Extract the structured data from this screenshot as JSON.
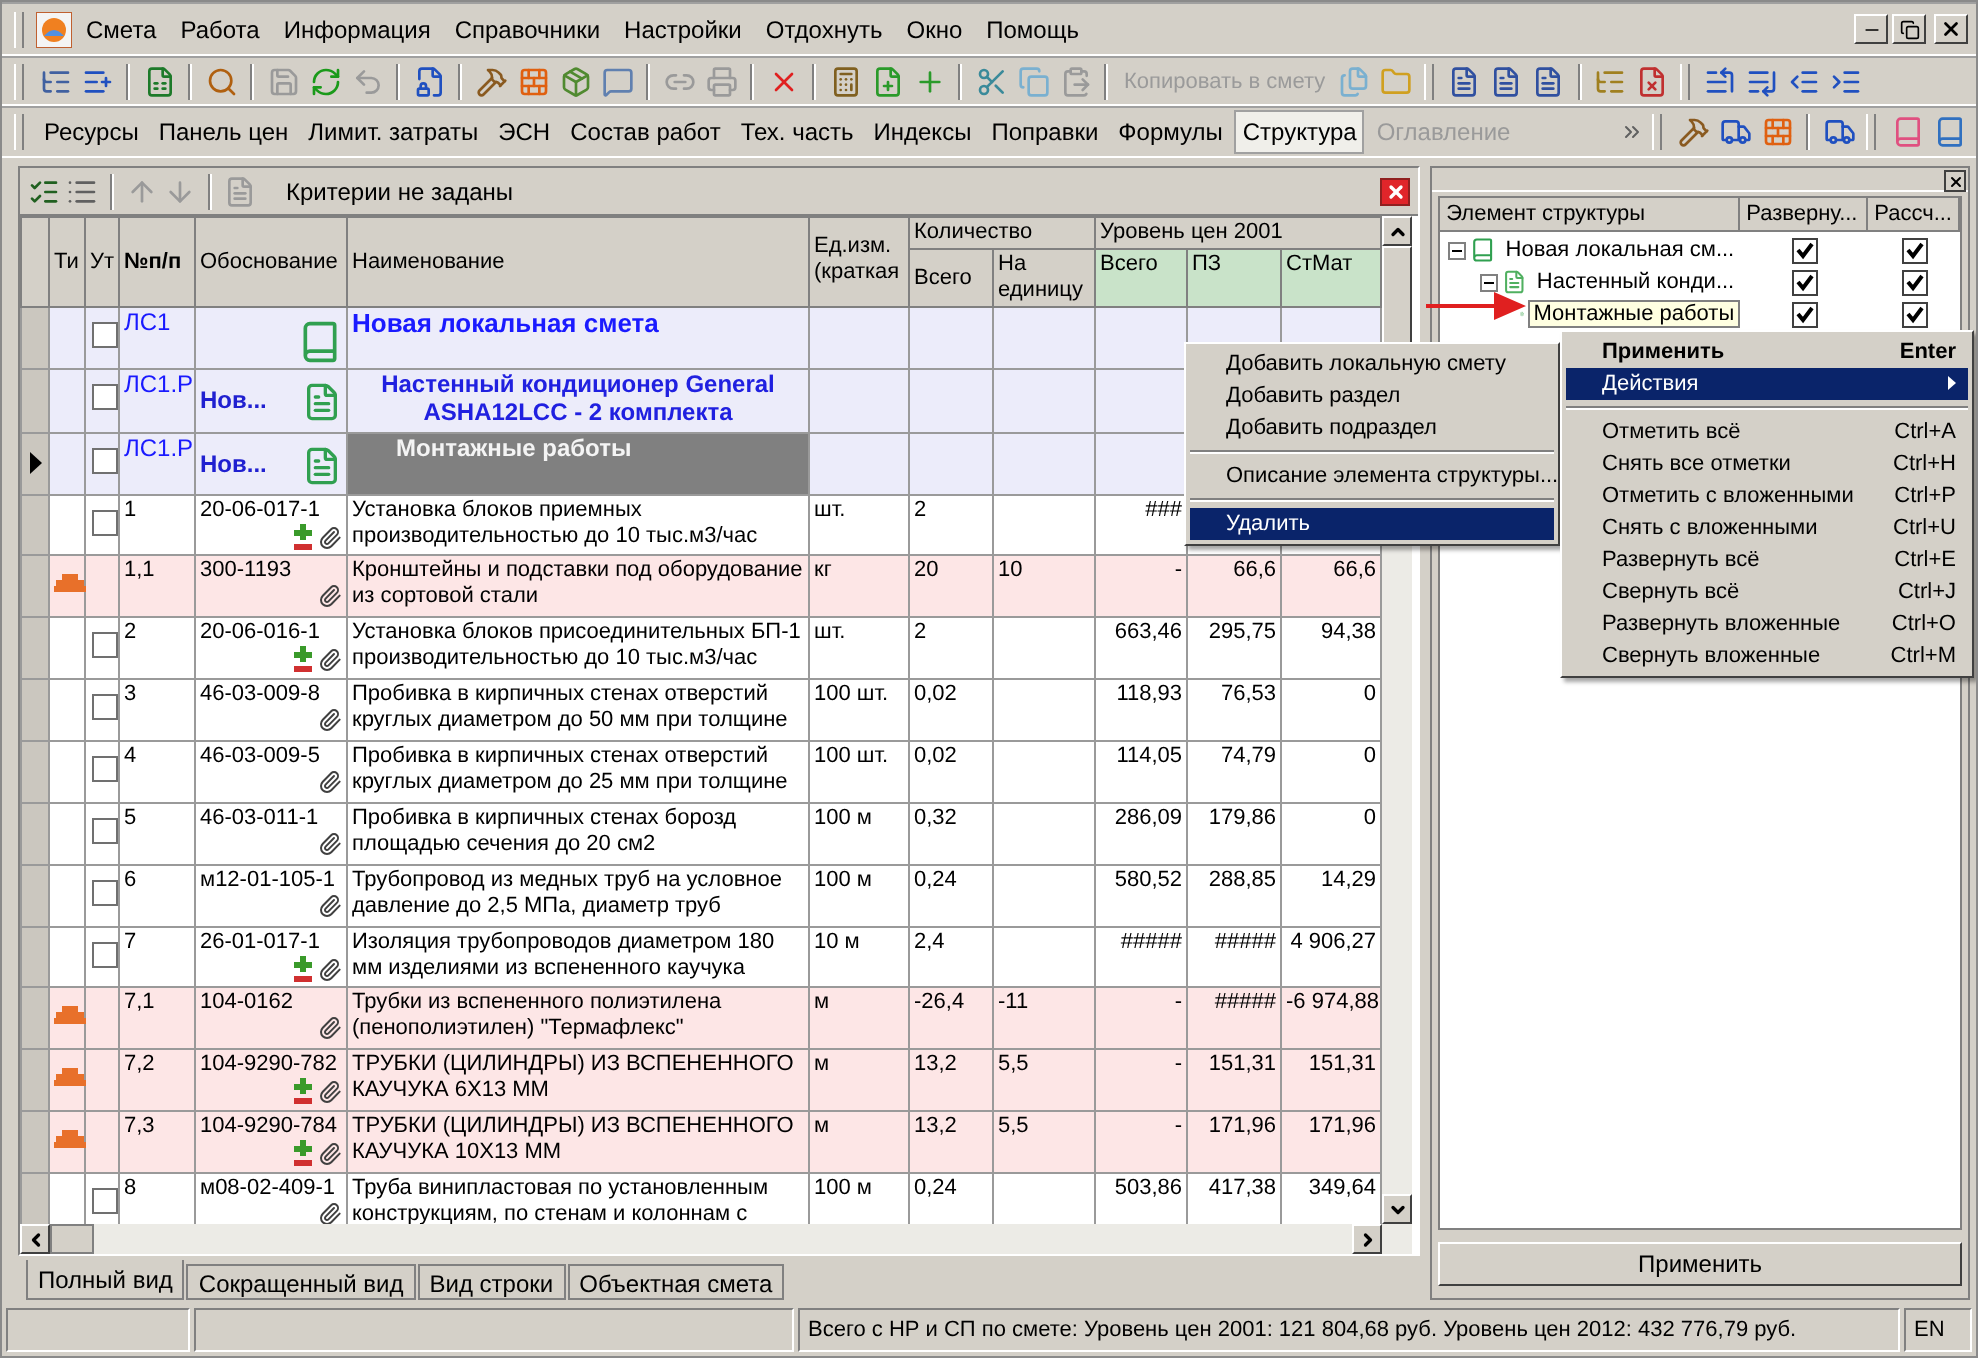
{
  "menu": [
    "Смета",
    "Работа",
    "Информация",
    "Справочники",
    "Настройки",
    "Отдохнуть",
    "Окно",
    "Помощь"
  ],
  "toolbar": {
    "copy_button": {
      "label": "Копировать в смету",
      "disabled": true
    }
  },
  "view_tabs": [
    {
      "label": "Ресурсы",
      "selected": false,
      "disabled": false
    },
    {
      "label": "Панель цен",
      "selected": false,
      "disabled": false
    },
    {
      "label": "Лимит. затраты",
      "selected": false,
      "disabled": false
    },
    {
      "label": "ЭСН",
      "selected": false,
      "disabled": false
    },
    {
      "label": "Состав работ",
      "selected": false,
      "disabled": false
    },
    {
      "label": "Тех. часть",
      "selected": false,
      "disabled": false
    },
    {
      "label": "Индексы",
      "selected": false,
      "disabled": false
    },
    {
      "label": "Поправки",
      "selected": false,
      "disabled": false
    },
    {
      "label": "Формулы",
      "selected": false,
      "disabled": false
    },
    {
      "label": "Структура",
      "selected": true,
      "disabled": false
    },
    {
      "label": "Оглавление",
      "selected": false,
      "disabled": true
    }
  ],
  "filter": {
    "text": "Критерии не заданы"
  },
  "table": {
    "columns": [
      "Ти",
      "Ут",
      "№п/п",
      "Обоснование",
      "Наименование",
      "Ед.изм. (краткая"
    ],
    "quantity_group": {
      "title": "Количество",
      "columns": [
        "Всего",
        "На единицу"
      ]
    },
    "price_group": {
      "title": "Уровень цен 2001",
      "columns": [
        "Всего",
        "ПЗ",
        "СтМат"
      ]
    },
    "rows": [
      {
        "kind": "estimate",
        "current": false,
        "checked": false,
        "number": "ЛС1",
        "name": "Новая локальная смета"
      },
      {
        "kind": "section",
        "current": false,
        "checked": false,
        "number": "ЛС1.Р",
        "basis": "Нов...",
        "name": "Настенный кондиционер General ASHA12LCC - 2 комплекта"
      },
      {
        "kind": "subsection",
        "current": true,
        "checked": false,
        "number": "ЛС1.Р",
        "basis": "Нов...",
        "name": "Монтажные работы"
      },
      {
        "kind": "work",
        "current": false,
        "checked": false,
        "number": "1",
        "basis": "20-06-017-1",
        "resources": true,
        "name": "Установка блоков приемных производительностью до 10 тыс.м3/час",
        "unit": "шт.",
        "qty_total": "2",
        "price_total": "###"
      },
      {
        "kind": "material",
        "current": false,
        "number": "1,1",
        "basis": "300-1193",
        "resources": false,
        "name": "Кронштейны и подставки под оборудование из сортовой стали",
        "unit": "кг",
        "qty_total": "20",
        "qty_per_unit": "10",
        "price_total": "-",
        "price_pz": "66,6",
        "price_mat": "66,6"
      },
      {
        "kind": "work",
        "current": false,
        "checked": false,
        "number": "2",
        "basis": "20-06-016-1",
        "resources": true,
        "name": "Установка блоков присоединительных БП-1 производительностью до 10 тыс.м3/час",
        "unit": "шт.",
        "qty_total": "2",
        "price_total": "663,46",
        "price_pz": "295,75",
        "price_mat": "94,38"
      },
      {
        "kind": "work",
        "current": false,
        "checked": false,
        "number": "3",
        "basis": "46-03-009-8",
        "resources": false,
        "name": "Пробивка в кирпичных стенах отверстий круглых диаметром до 50 мм при толщине",
        "unit": "100 шт.",
        "qty_total": "0,02",
        "price_total": "118,93",
        "price_pz": "76,53",
        "price_mat": "0"
      },
      {
        "kind": "work",
        "current": false,
        "checked": false,
        "number": "4",
        "basis": "46-03-009-5",
        "resources": false,
        "name": "Пробивка в кирпичных стенах отверстий круглых диаметром до 25 мм при толщине",
        "unit": "100 шт.",
        "qty_total": "0,02",
        "price_total": "114,05",
        "price_pz": "74,79",
        "price_mat": "0"
      },
      {
        "kind": "work",
        "current": false,
        "checked": false,
        "number": "5",
        "basis": "46-03-011-1",
        "resources": false,
        "name": "Пробивка в кирпичных стенах борозд площадью сечения до 20 см2",
        "unit": "100 м",
        "qty_total": "0,32",
        "price_total": "286,09",
        "price_pz": "179,86",
        "price_mat": "0"
      },
      {
        "kind": "work",
        "current": false,
        "checked": false,
        "number": "6",
        "basis": "м12-01-105-1",
        "resources": false,
        "name": "Трубопровод из медных труб на условное давление до 2,5 МПа, диаметр труб",
        "unit": "100 м",
        "qty_total": "0,24",
        "price_total": "580,52",
        "price_pz": "288,85",
        "price_mat": "14,29"
      },
      {
        "kind": "work",
        "current": false,
        "checked": false,
        "number": "7",
        "basis": "26-01-017-1",
        "resources": true,
        "name": "Изоляция трубопроводов диаметром 180 мм изделиями из вспененного каучука",
        "unit": "10 м",
        "qty_total": "2,4",
        "price_total": "#####",
        "price_pz": "#####",
        "price_mat": "4 906,27"
      },
      {
        "kind": "material",
        "current": false,
        "number": "7,1",
        "basis": "104-0162",
        "resources": false,
        "name": "Трубки из вспененного полиэтилена (пенополиэтилен) \"Термафлекс\"",
        "unit": "м",
        "qty_total": "-26,4",
        "qty_per_unit": "-11",
        "price_total": "-",
        "price_pz": "#####",
        "price_mat": "-6 974,88"
      },
      {
        "kind": "material",
        "current": false,
        "number": "7,2",
        "basis": "104-9290-782",
        "resources": true,
        "name": "ТРУБКИ (ЦИЛИНДРЫ) ИЗ ВСПЕНЕННОГО КАУЧУКА 6Х13 ММ",
        "unit": "м",
        "qty_total": "13,2",
        "qty_per_unit": "5,5",
        "price_total": "-",
        "price_pz": "151,31",
        "price_mat": "151,31"
      },
      {
        "kind": "material",
        "current": false,
        "number": "7,3",
        "basis": "104-9290-784",
        "resources": true,
        "name": "ТРУБКИ (ЦИЛИНДРЫ) ИЗ ВСПЕНЕННОГО КАУЧУКА 10Х13 ММ",
        "unit": "м",
        "qty_total": "13,2",
        "qty_per_unit": "5,5",
        "price_total": "-",
        "price_pz": "171,96",
        "price_mat": "171,96"
      },
      {
        "kind": "work",
        "current": false,
        "checked": false,
        "number": "8",
        "basis": "м08-02-409-1",
        "resources": false,
        "name": "Труба винипластовая по установленным конструкциям, по стенам и колоннам с",
        "unit": "100 м",
        "qty_total": "0,24",
        "price_total": "503,86",
        "price_pz": "417,38",
        "price_mat": "349,64"
      }
    ]
  },
  "bottom_tabs": [
    {
      "label": "Полный вид",
      "selected": true
    },
    {
      "label": "Сокращенный вид",
      "selected": false
    },
    {
      "label": "Вид строки",
      "selected": false
    },
    {
      "label": "Объектная смета",
      "selected": false
    }
  ],
  "structure": {
    "columns": [
      "Элемент структуры",
      "Разверну...",
      "Рассч..."
    ],
    "items": [
      {
        "label": "Новая локальная см...",
        "expanded": true,
        "unfold": true,
        "calculate": true,
        "selected": false,
        "children": [
          {
            "label": "Настенный конди...",
            "expanded": true,
            "unfold": true,
            "calculate": true,
            "selected": false,
            "children": [
              {
                "label": "Монтажные работы",
                "unfold": true,
                "calculate": true,
                "selected": true
              }
            ]
          }
        ]
      }
    ],
    "button": "Применить"
  },
  "context_menu": {
    "items": [
      {
        "kind": "item",
        "label": "Добавить локальную смету",
        "selected": false
      },
      {
        "kind": "item",
        "label": "Добавить раздел",
        "selected": false
      },
      {
        "kind": "item",
        "label": "Добавить подраздел",
        "selected": false
      },
      {
        "kind": "separator"
      },
      {
        "kind": "item",
        "label": "Описание элемента структуры...",
        "selected": false
      },
      {
        "kind": "separator"
      },
      {
        "kind": "item",
        "label": "Удалить",
        "selected": true
      }
    ]
  },
  "actions_menu": {
    "items": [
      {
        "kind": "item",
        "label": "Применить",
        "shortcut": "Enter",
        "default": true,
        "selected": false
      },
      {
        "kind": "submenu",
        "label": "Действия",
        "selected": true
      },
      {
        "kind": "separator"
      },
      {
        "kind": "item",
        "label": "Отметить всё",
        "shortcut": "Ctrl+A",
        "selected": false
      },
      {
        "kind": "item",
        "label": "Снять все отметки",
        "shortcut": "Ctrl+H",
        "selected": false
      },
      {
        "kind": "item",
        "label": "Отметить с вложенными",
        "shortcut": "Ctrl+P",
        "selected": false
      },
      {
        "kind": "item",
        "label": "Снять с вложенными",
        "shortcut": "Ctrl+U",
        "selected": false
      },
      {
        "kind": "item",
        "label": "Развернуть всё",
        "shortcut": "Ctrl+E",
        "selected": false
      },
      {
        "kind": "item",
        "label": "Свернуть всё",
        "shortcut": "Ctrl+J",
        "selected": false
      },
      {
        "kind": "item",
        "label": "Развернуть вложенные",
        "shortcut": "Ctrl+O",
        "selected": false
      },
      {
        "kind": "item",
        "label": "Свернуть вложенные",
        "shortcut": "Ctrl+M",
        "selected": false
      }
    ]
  },
  "status_bar": {
    "summary": "Всего с НР и СП по смете: Уровень цен 2001: 121 804,68 руб. Уровень цен 2012: 432 776,79 руб.",
    "language": "EN"
  }
}
